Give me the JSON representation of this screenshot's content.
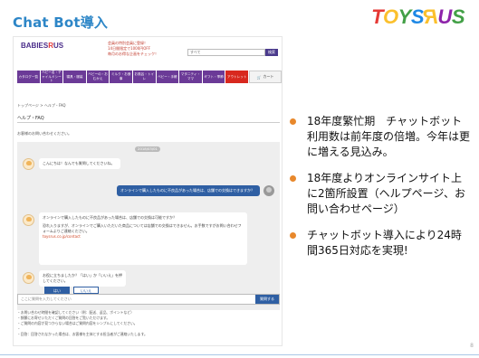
{
  "slide": {
    "title": "Chat Bot導入",
    "logo_letters": [
      "T",
      "O",
      "Y",
      "S",
      "R",
      "U",
      "S"
    ],
    "logo_colors": [
      "#e53935",
      "#fbc02d",
      "#43a047",
      "#1e88e5",
      "#fbc02d",
      "#8e24aa",
      "#43a047"
    ],
    "page_number": "8"
  },
  "site": {
    "logo_main": "BABIES",
    "logo_r": "R",
    "logo_us": "US",
    "promo_lines": [
      "会員の特別会員に登録！",
      "14日間限定で1000円OFF",
      "毎月のお得な企画をチェック！"
    ],
    "search_placeholder": "すべて",
    "search_button": "検索",
    "categories": [
      "カタログ一覧",
      "ベビー名・チャイルドシート",
      "寝具・服装",
      "ベビーの・おむかえ",
      "ミルク・お食事",
      "お風呂・トイレ",
      "ベビー・手帳",
      "マタニティ・ママ",
      "ギフト・季節",
      "アウトレット"
    ],
    "cart_label": "カート",
    "breadcrumb": "トップページ > ヘルプ・FAQ",
    "faq_title": "ヘルプ・FAQ",
    "faq_note": "お客様のお問い合わせください。",
    "chat": {
      "date": "2018/03/01",
      "bot_greeting": "こんにちは！なんでも質問してくださいね。",
      "user_question": "オンラインで購入したものに不良品があった場合は、店舗での交換はできますか？",
      "bot_answer_q": "オンラインで購入したものに不良品があった場合は、店舗での交換は可能ですか？",
      "bot_answer": "恐れ入りますが、オンラインでご購入いただいた商品については店舗での交換はできません。お手数ですがお問い合わせフォームよりご連絡ください。",
      "bot_answer_link": "toysrus.co.jp/contact",
      "bot_ask": "お役に立ちましたか？「はい」か「いいえ」を押してください。",
      "choice_yes": "はい",
      "choice_no": "いいえ"
    },
    "input_placeholder": "ここに質問を入力してください",
    "send_button": "質問する",
    "notes": [
      "・お問い合わせ時間を確認してください（例：配送、返品、ポイントなど）",
      "・頻繁にお寄せいただくご質問の回答をご覧いただけます。",
      "・ご質問の内容が見つからない場合はご質問内容をシンプルにしてください。",
      "・",
      "・回答：回答されなかった場合は、お客様を主体とする担当者がご連絡いたします。"
    ]
  },
  "bullets": [
    "18年度繁忙期　チャットボット利用数は前年度の倍増。今年は更に増える見込み。",
    "18年度よりオンラインサイト上に2箇所設置（ヘルプページ、お問い合わせページ）",
    "チャットボット導入により24時間365日対応を実現!"
  ],
  "colors": {
    "title": "#2d86c7",
    "bullet": "#e8882c",
    "category": "#6b3a97",
    "chat_accent": "#2f5fa3"
  }
}
